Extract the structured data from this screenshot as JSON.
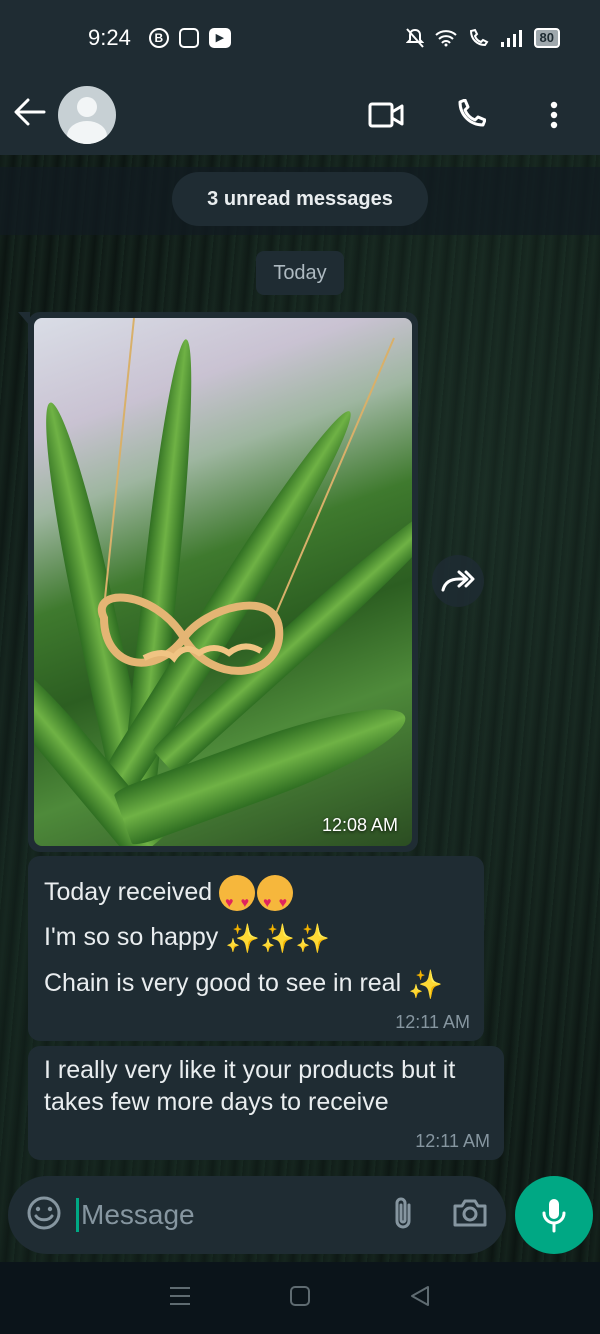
{
  "status_bar": {
    "time": "9:24",
    "icons": [
      "b-icon",
      "instagram-icon",
      "youtube-icon"
    ],
    "right_icons": [
      "mute-icon",
      "wifi-icon",
      "wifi-call-icon",
      "signal-icon"
    ],
    "battery": "80"
  },
  "header": {
    "actions": [
      "video-call-icon",
      "voice-call-icon",
      "more-icon"
    ]
  },
  "chat": {
    "unread_label": "3 unread messages",
    "date_label": "Today",
    "image_message": {
      "time": "12:08 AM"
    },
    "messages": [
      {
        "lines": [
          "Today received",
          "I'm so so happy",
          "Chain is very good to see in real"
        ],
        "time": "12:11 AM"
      },
      {
        "lines": [
          "I really very like it your products but it",
          "takes few more days to receive"
        ],
        "time": "12:11 AM"
      }
    ]
  },
  "composer": {
    "placeholder": "Message"
  },
  "colors": {
    "bar": "#1f2c33",
    "accent": "#00a884",
    "bubble": "#1f2c33"
  }
}
